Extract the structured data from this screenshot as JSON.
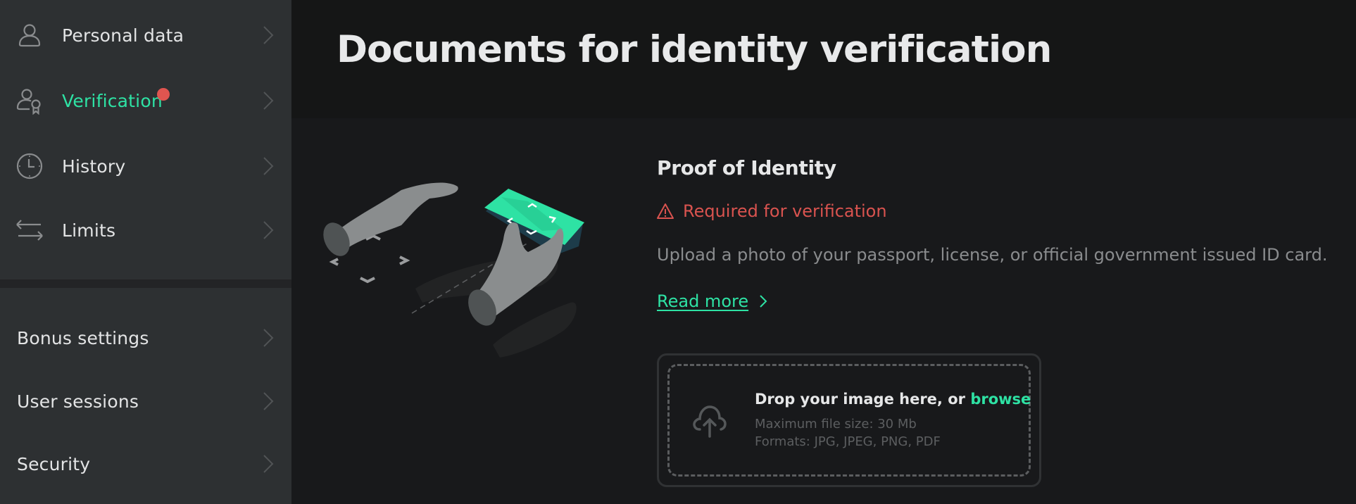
{
  "sidebar": {
    "items": [
      {
        "label": "Personal data",
        "icon": "user-icon",
        "active": false
      },
      {
        "label": "Verification",
        "icon": "user-award-icon",
        "active": true,
        "notification_dot": true
      },
      {
        "label": "History",
        "icon": "clock-icon",
        "active": false
      },
      {
        "label": "Limits",
        "icon": "arrows-exchange-icon",
        "active": false
      }
    ],
    "secondary_items": [
      {
        "label": "Bonus settings"
      },
      {
        "label": "User sessions"
      },
      {
        "label": "Security"
      }
    ]
  },
  "header": {
    "title": "Documents for identity verification"
  },
  "document": {
    "title": "Proof of Identity",
    "status": "Required for verification",
    "status_icon": "warning-triangle-icon",
    "description": "Upload a photo of your passport, license, or official government issued ID card.",
    "read_more": "Read more"
  },
  "upload": {
    "prompt": "Drop your image here, or ",
    "browse": "browse",
    "max_size": "Maximum file size: 30 Mb",
    "formats": "Formats: JPG, JPEG, PNG, PDF",
    "icon": "cloud-upload-icon"
  },
  "colors": {
    "accent": "#2ee2a4",
    "danger": "#d9534f",
    "sidebar_bg": "#2d3032",
    "main_bg": "#18191b",
    "header_bg": "#151616"
  }
}
